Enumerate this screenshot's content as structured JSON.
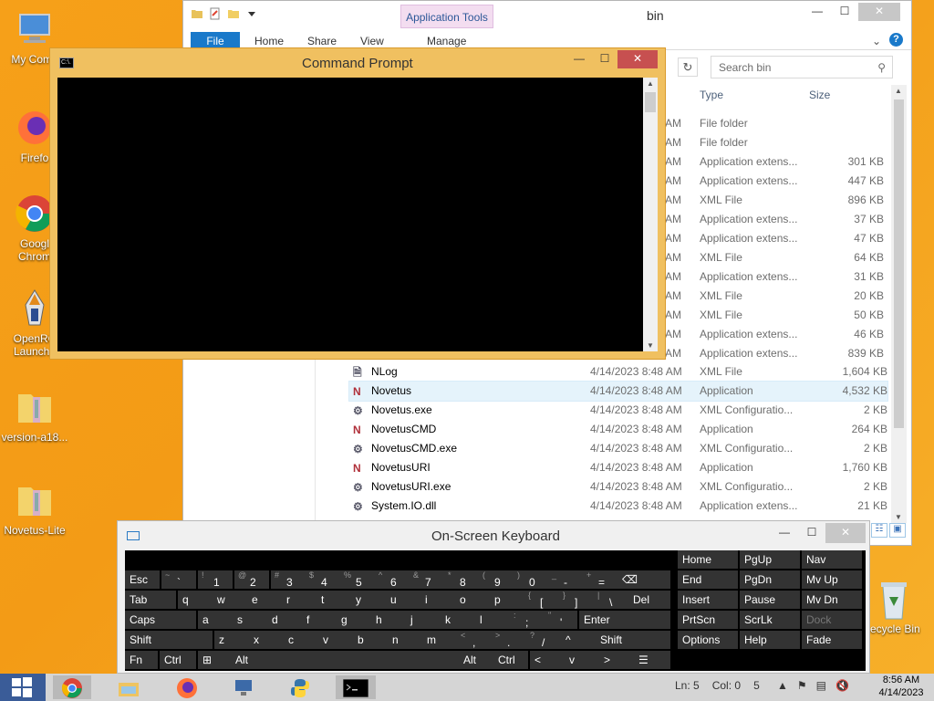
{
  "desktop": {
    "icons": [
      {
        "label": "My Comp",
        "icon": "computer-icon"
      },
      {
        "label": "Firefo",
        "icon": "firefox-icon"
      },
      {
        "label": "Googl\nChrom",
        "icon": "chrome-icon"
      },
      {
        "label": "OpenRC\nLaunche",
        "icon": "openrct-launcher-icon"
      },
      {
        "label": "version-a18...",
        "icon": "zip-folder-icon"
      },
      {
        "label": "Novetus-Lite",
        "icon": "zip-folder-icon"
      }
    ],
    "recycle_label": "ecycle Bin"
  },
  "explorer": {
    "title": "bin",
    "context_tab": "Application Tools",
    "tabs": [
      "File",
      "Home",
      "Share",
      "View",
      "Manage"
    ],
    "search_placeholder": "Search bin",
    "columns": {
      "type": "Type",
      "size": "Size"
    },
    "partial_rows": [
      {
        "time": "AM",
        "type": "File folder",
        "size": ""
      },
      {
        "time": "AM",
        "type": "File folder",
        "size": ""
      },
      {
        "time": "AM",
        "type": "Application extens...",
        "size": "301 KB"
      },
      {
        "time": "AM",
        "type": "Application extens...",
        "size": "447 KB"
      },
      {
        "time": "AM",
        "type": "XML File",
        "size": "896 KB"
      },
      {
        "time": "AM",
        "type": "Application extens...",
        "size": "37 KB"
      },
      {
        "time": "AM",
        "type": "Application extens...",
        "size": "47 KB"
      },
      {
        "time": "AM",
        "type": "XML File",
        "size": "64 KB"
      },
      {
        "time": "AM",
        "type": "Application extens...",
        "size": "31 KB"
      },
      {
        "time": "AM",
        "type": "XML File",
        "size": "20 KB"
      },
      {
        "time": "AM",
        "type": "XML File",
        "size": "50 KB"
      },
      {
        "time": "AM",
        "type": "Application extens...",
        "size": "46 KB"
      },
      {
        "time": "AM",
        "type": "Application extens...",
        "size": "839 KB"
      }
    ],
    "files": [
      {
        "name": "NLog",
        "date": "4/14/2023 8:48 AM",
        "type": "XML File",
        "size": "1,604 KB",
        "icon": "xml-file-icon"
      },
      {
        "name": "Novetus",
        "date": "4/14/2023 8:48 AM",
        "type": "Application",
        "size": "4,532 KB",
        "icon": "novetus-app-icon",
        "selected": true
      },
      {
        "name": "Novetus.exe",
        "date": "4/14/2023 8:48 AM",
        "type": "XML Configuratio...",
        "size": "2 KB",
        "icon": "config-file-icon"
      },
      {
        "name": "NovetusCMD",
        "date": "4/14/2023 8:48 AM",
        "type": "Application",
        "size": "264 KB",
        "icon": "novetus-app-icon"
      },
      {
        "name": "NovetusCMD.exe",
        "date": "4/14/2023 8:48 AM",
        "type": "XML Configuratio...",
        "size": "2 KB",
        "icon": "config-file-icon"
      },
      {
        "name": "NovetusURI",
        "date": "4/14/2023 8:48 AM",
        "type": "Application",
        "size": "1,760 KB",
        "icon": "novetus-app-icon"
      },
      {
        "name": "NovetusURI.exe",
        "date": "4/14/2023 8:48 AM",
        "type": "XML Configuratio...",
        "size": "2 KB",
        "icon": "config-file-icon"
      },
      {
        "name": "System.IO.dll",
        "date": "4/14/2023 8:48 AM",
        "type": "Application extens...",
        "size": "21 KB",
        "icon": "dll-file-icon"
      }
    ]
  },
  "cmd": {
    "title": "Command Prompt",
    "icon_text": "C:\\."
  },
  "osk": {
    "title": "On-Screen Keyboard",
    "rows": [
      [
        {
          "sh": "",
          "k": "Esc"
        },
        {
          "sh": "~",
          "k": "`"
        },
        {
          "sh": "!",
          "k": "1"
        },
        {
          "sh": "@",
          "k": "2"
        },
        {
          "sh": "#",
          "k": "3"
        },
        {
          "sh": "$",
          "k": "4"
        },
        {
          "sh": "%",
          "k": "5"
        },
        {
          "sh": "^",
          "k": "6"
        },
        {
          "sh": "&",
          "k": "7"
        },
        {
          "sh": "*",
          "k": "8"
        },
        {
          "sh": "(",
          "k": "9"
        },
        {
          "sh": ")",
          "k": "0"
        },
        {
          "sh": "_",
          "k": "-"
        },
        {
          "sh": "+",
          "k": "="
        },
        {
          "sh": "",
          "k": "⌫"
        }
      ],
      [
        {
          "sh": "",
          "k": "Tab"
        },
        {
          "sh": "",
          "k": "q"
        },
        {
          "sh": "",
          "k": "w"
        },
        {
          "sh": "",
          "k": "e"
        },
        {
          "sh": "",
          "k": "r"
        },
        {
          "sh": "",
          "k": "t"
        },
        {
          "sh": "",
          "k": "y"
        },
        {
          "sh": "",
          "k": "u"
        },
        {
          "sh": "",
          "k": "i"
        },
        {
          "sh": "",
          "k": "o"
        },
        {
          "sh": "",
          "k": "p"
        },
        {
          "sh": "{",
          "k": "["
        },
        {
          "sh": "}",
          "k": "]"
        },
        {
          "sh": "|",
          "k": "\\"
        },
        {
          "sh": "",
          "k": "Del"
        }
      ],
      [
        {
          "sh": "",
          "k": "Caps"
        },
        {
          "sh": "",
          "k": "a"
        },
        {
          "sh": "",
          "k": "s"
        },
        {
          "sh": "",
          "k": "d"
        },
        {
          "sh": "",
          "k": "f"
        },
        {
          "sh": "",
          "k": "g"
        },
        {
          "sh": "",
          "k": "h"
        },
        {
          "sh": "",
          "k": "j"
        },
        {
          "sh": "",
          "k": "k"
        },
        {
          "sh": "",
          "k": "l"
        },
        {
          "sh": ":",
          "k": ";"
        },
        {
          "sh": "\"",
          "k": "'"
        },
        {
          "sh": "",
          "k": "Enter"
        }
      ],
      [
        {
          "sh": "",
          "k": "Shift"
        },
        {
          "sh": "",
          "k": "z"
        },
        {
          "sh": "",
          "k": "x"
        },
        {
          "sh": "",
          "k": "c"
        },
        {
          "sh": "",
          "k": "v"
        },
        {
          "sh": "",
          "k": "b"
        },
        {
          "sh": "",
          "k": "n"
        },
        {
          "sh": "",
          "k": "m"
        },
        {
          "sh": "<",
          "k": ","
        },
        {
          "sh": ">",
          "k": "."
        },
        {
          "sh": "?",
          "k": "/"
        },
        {
          "sh": "",
          "k": "^"
        },
        {
          "sh": "",
          "k": "Shift"
        }
      ],
      [
        {
          "sh": "",
          "k": "Fn"
        },
        {
          "sh": "",
          "k": "Ctrl"
        },
        {
          "sh": "",
          "k": "⊞"
        },
        {
          "sh": "",
          "k": "Alt"
        },
        {
          "sh": "",
          "k": ""
        },
        {
          "sh": "",
          "k": "Alt"
        },
        {
          "sh": "",
          "k": "Ctrl"
        },
        {
          "sh": "",
          "k": "<"
        },
        {
          "sh": "",
          "k": "v"
        },
        {
          "sh": "",
          "k": ">"
        },
        {
          "sh": "",
          "k": "☰"
        }
      ]
    ],
    "nav_keys": [
      [
        "Home",
        "PgUp",
        "Nav"
      ],
      [
        "End",
        "PgDn",
        "Mv Up"
      ],
      [
        "Insert",
        "Pause",
        "Mv Dn"
      ],
      [
        "PrtScn",
        "ScrLk",
        "Dock"
      ],
      [
        "Options",
        "Help",
        "Fade"
      ]
    ]
  },
  "statusbar": {
    "ln": "Ln: 5",
    "col": "Col: 0",
    "num": "5"
  },
  "taskbar": {
    "time": "8:56 AM",
    "date": "4/14/2023"
  }
}
